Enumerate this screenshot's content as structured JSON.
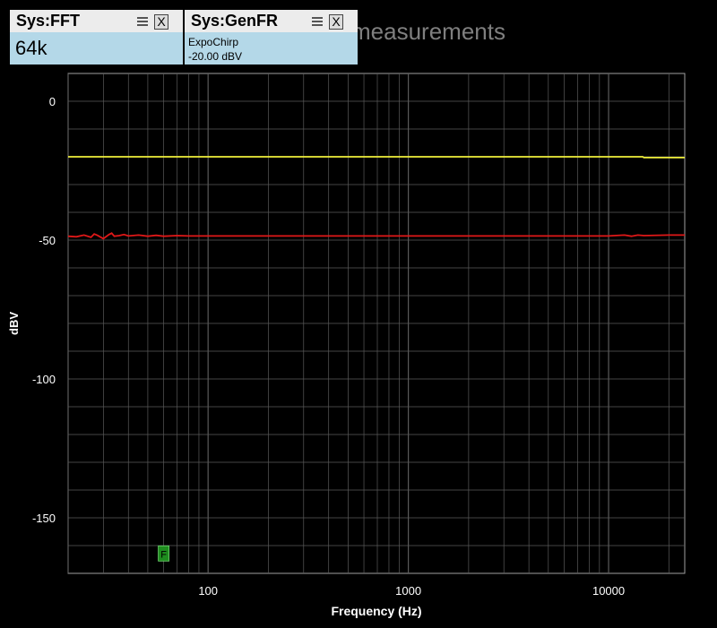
{
  "background_title": "measurements",
  "panels": {
    "fft": {
      "title": "Sys:FFT",
      "value": "64k"
    },
    "genfr": {
      "title": "Sys:GenFR",
      "signal": "ExpoChirp",
      "level": "-20.00 dBV"
    },
    "close_label": "X"
  },
  "marker_label": "F",
  "colors": {
    "background": "#000000",
    "grid": "#5a5a5a",
    "axis_text": "#ffffff",
    "panel_bg": "#b4d8e8",
    "panel_header": "#ececec",
    "series_yellow": "#f0f03c",
    "series_red": "#e01818",
    "marker_bg": "#1e8c1e"
  },
  "chart_data": {
    "type": "line",
    "xscale": "log",
    "xlim": [
      20,
      24000
    ],
    "ylim": [
      -170,
      10
    ],
    "xlabel": "Frequency (Hz)",
    "ylabel": "dBV",
    "x_ticks": [
      {
        "value": 100,
        "label": "100"
      },
      {
        "value": 1000,
        "label": "1000"
      },
      {
        "value": 10000,
        "label": "10000"
      }
    ],
    "y_ticks": [
      {
        "value": 0,
        "label": "0"
      },
      {
        "value": -50,
        "label": "-50"
      },
      {
        "value": -100,
        "label": "-100"
      },
      {
        "value": -150,
        "label": "-150"
      }
    ],
    "grid": true,
    "series": [
      {
        "color": "#f0f03c",
        "x": [
          20,
          50,
          100,
          1000,
          10000,
          14800,
          15000,
          24000
        ],
        "y": [
          -20.0,
          -20.0,
          -20.0,
          -20.0,
          -20.0,
          -20.0,
          -20.3,
          -20.3
        ]
      },
      {
        "color": "#e01818",
        "x": [
          20,
          22,
          24,
          26,
          27,
          28,
          30,
          32,
          33,
          34,
          36,
          38,
          40,
          45,
          50,
          55,
          60,
          70,
          80,
          100,
          200,
          500,
          1000,
          2000,
          5000,
          10000,
          12000,
          13000,
          14000,
          15000,
          20000,
          24000
        ],
        "y": [
          -48.6,
          -48.8,
          -48.2,
          -49.0,
          -47.8,
          -48.3,
          -49.5,
          -48.0,
          -47.5,
          -48.6,
          -48.4,
          -48.0,
          -48.5,
          -48.2,
          -48.6,
          -48.3,
          -48.6,
          -48.4,
          -48.5,
          -48.5,
          -48.5,
          -48.5,
          -48.5,
          -48.5,
          -48.5,
          -48.5,
          -48.2,
          -48.6,
          -48.2,
          -48.4,
          -48.2,
          -48.2
        ]
      }
    ],
    "markers": [
      {
        "x": 60,
        "y": -163,
        "label": "F"
      }
    ]
  }
}
